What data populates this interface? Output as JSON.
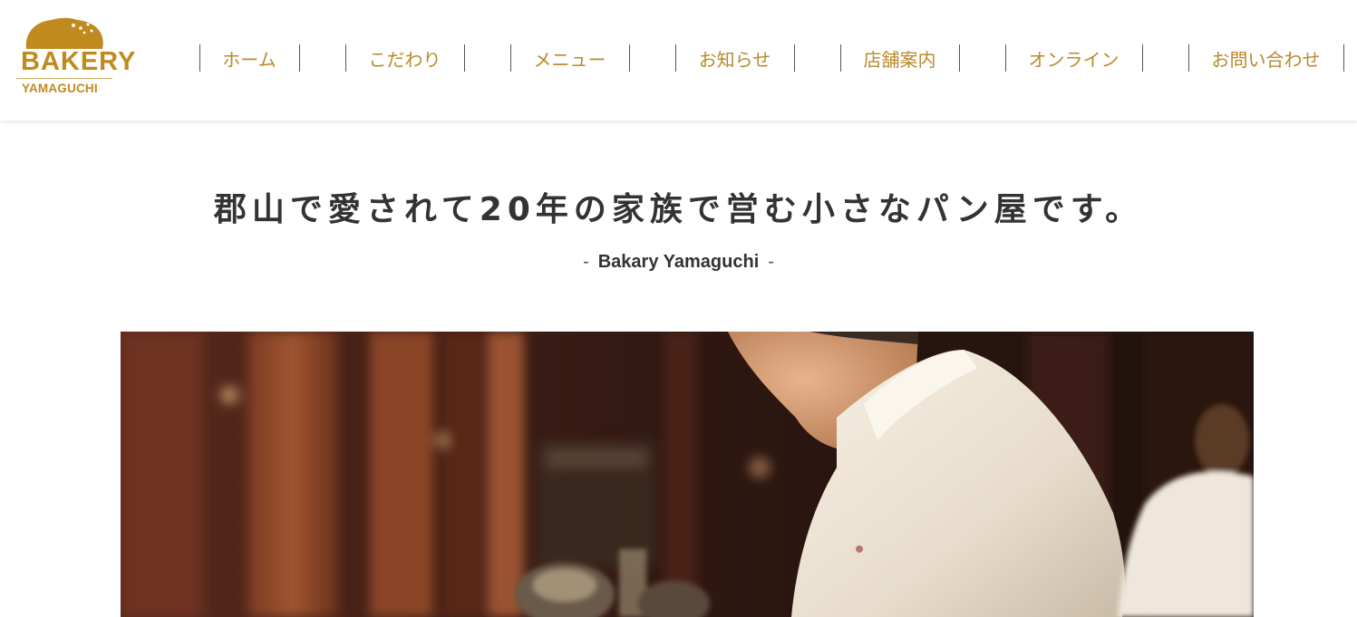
{
  "logo": {
    "line1": "BAKERY",
    "line2": "YAMAGUCHI",
    "color": "#c08a1e"
  },
  "nav": {
    "items": [
      {
        "label": "ホーム"
      },
      {
        "label": "こだわり"
      },
      {
        "label": "メニュー"
      },
      {
        "label": "お知らせ"
      },
      {
        "label": "店舗案内"
      },
      {
        "label": "オンライン"
      },
      {
        "label": "お問い合わせ"
      }
    ],
    "color": "#b98a2a"
  },
  "hero": {
    "title": "郡山で愛されて20年の家族で営む小さなパン屋です。",
    "subtitle_dash_left": "-",
    "subtitle": "Bakary Yamaguchi",
    "subtitle_dash_right": "-"
  },
  "photo": {
    "icon": "bakery-kitchen-photo"
  }
}
